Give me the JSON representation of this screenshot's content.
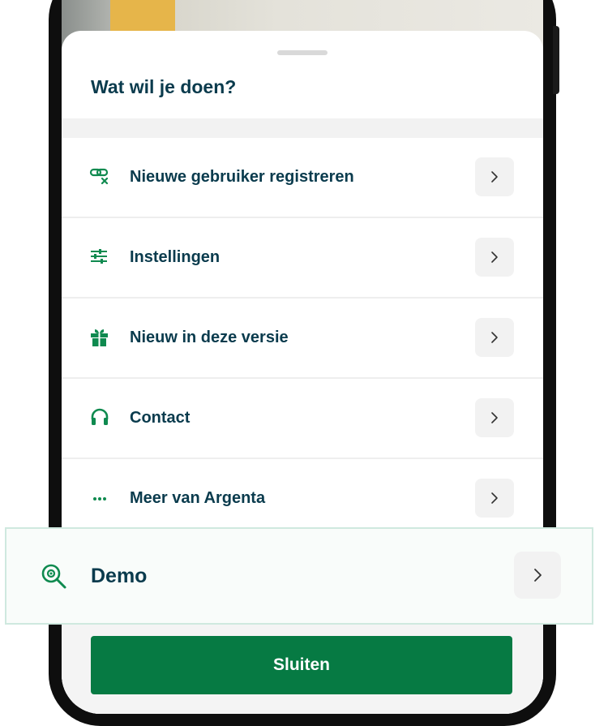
{
  "sheet": {
    "title": "Wat wil je doen?"
  },
  "menu": {
    "items": [
      {
        "label": "Nieuwe gebruiker registreren",
        "icon": "link-remove-icon"
      },
      {
        "label": "Instellingen",
        "icon": "sliders-icon"
      },
      {
        "label": "Nieuw in deze versie",
        "icon": "gift-icon"
      },
      {
        "label": "Contact",
        "icon": "headset-icon"
      },
      {
        "label": "Meer van Argenta",
        "icon": "more-dots-icon"
      }
    ]
  },
  "demo": {
    "label": "Demo",
    "icon": "demo-search-icon"
  },
  "actions": {
    "close_label": "Sluiten"
  },
  "colors": {
    "brand_green": "#067a43",
    "icon_green": "#0f8a4f",
    "text_navy": "#0a3b4d"
  }
}
